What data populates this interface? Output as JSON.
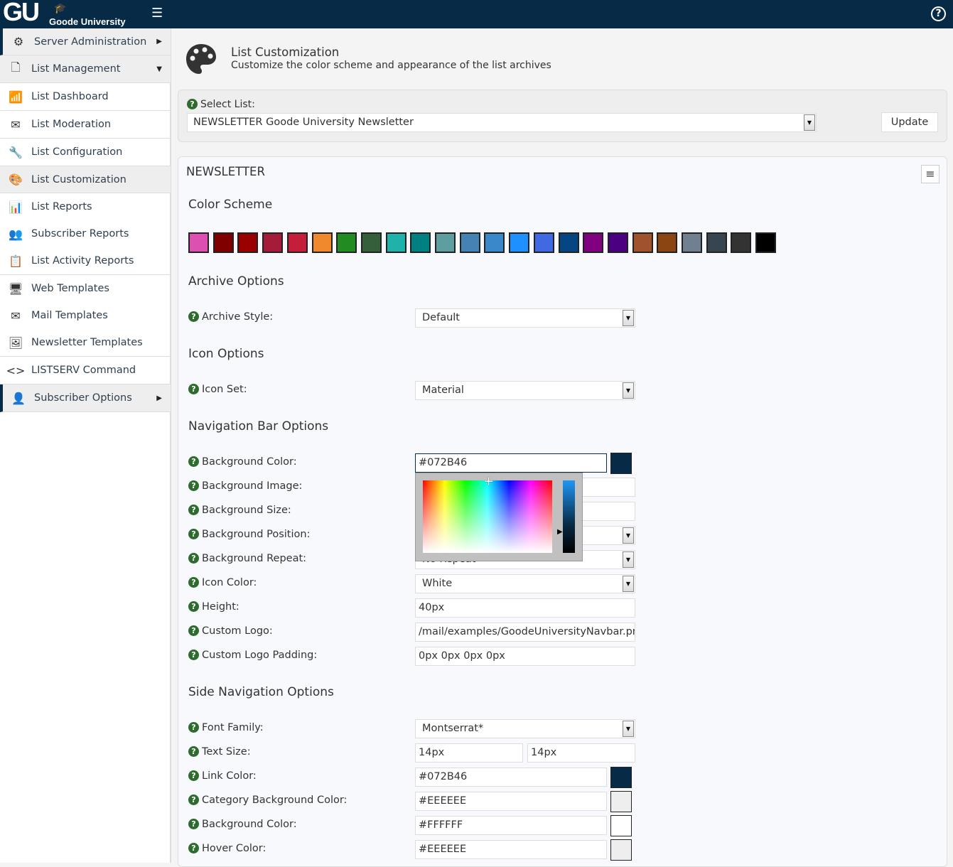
{
  "header": {
    "logo_mark": "GU",
    "logo_name": "Goode University",
    "bg": "#072B46"
  },
  "sidebar": {
    "items": [
      {
        "label": "Server Administration",
        "icon": "gear-icon",
        "glyph": "⚙",
        "arrow": "▶"
      },
      {
        "label": "List Management",
        "icon": "document-icon",
        "glyph": "🗋",
        "arrow": "▼"
      },
      {
        "label": "List Dashboard",
        "icon": "dashboard-icon",
        "glyph": "📶"
      },
      {
        "label": "List Moderation",
        "icon": "mail-search-icon",
        "glyph": "✉"
      },
      {
        "label": "List Configuration",
        "icon": "wrench-icon",
        "glyph": "🔧"
      },
      {
        "label": "List Customization",
        "icon": "palette-icon",
        "glyph": "🎨"
      },
      {
        "label": "List Reports",
        "icon": "bar-chart-icon",
        "glyph": "📊"
      },
      {
        "label": "Subscriber Reports",
        "icon": "people-icon",
        "glyph": "👥"
      },
      {
        "label": "List Activity Reports",
        "icon": "clipboard-icon",
        "glyph": "📋"
      },
      {
        "label": "Web Templates",
        "icon": "devices-icon",
        "glyph": "🖥"
      },
      {
        "label": "Mail Templates",
        "icon": "envelope-icon",
        "glyph": "✉"
      },
      {
        "label": "Newsletter Templates",
        "icon": "image-icon",
        "glyph": "🖼"
      },
      {
        "label": "LISTSERV Command",
        "icon": "code-icon",
        "glyph": "<>"
      },
      {
        "label": "Subscriber Options",
        "icon": "person-icon",
        "glyph": "👤",
        "arrow": "▶"
      }
    ]
  },
  "page": {
    "title": "List Customization",
    "subtitle": "Customize the color scheme and appearance of the list archives"
  },
  "select_list": {
    "label": "Select List:",
    "value": "NEWSLETTER Goode University Newsletter",
    "update": "Update"
  },
  "panel": {
    "title": "NEWSLETTER"
  },
  "sections": {
    "color_scheme": "Color Scheme",
    "archive": "Archive Options",
    "icon": "Icon Options",
    "navbar": "Navigation Bar Options",
    "sidenav": "Side Navigation Options"
  },
  "swatches": [
    "#DD4FB0",
    "#800000",
    "#990000",
    "#A51C3A",
    "#C41E3A",
    "#F0882E",
    "#228B22",
    "#355E3B",
    "#20B2AA",
    "#008080",
    "#5F9EA0",
    "#4682B4",
    "#3A87CA",
    "#1E90FF",
    "#4169E1",
    "#054584",
    "#800080",
    "#4B0082",
    "#A0522D",
    "#8B4513",
    "#708090",
    "#36454F",
    "#333333",
    "#000000"
  ],
  "rows": [
    {
      "label": "Archive Style:",
      "type": "select",
      "value": "Default"
    },
    {
      "label": "Icon Set:",
      "type": "select",
      "value": "Material"
    },
    {
      "label": "Background Color:",
      "type": "color",
      "value": "#072B46",
      "swatch": "#072B46"
    },
    {
      "label": "Background Image:",
      "type": "text",
      "value": ""
    },
    {
      "label": "Background Size:",
      "type": "text",
      "value": ""
    },
    {
      "label": "Background Position:",
      "type": "select",
      "value": ""
    },
    {
      "label": "Background Repeat:",
      "type": "select",
      "value": "No Repeat"
    },
    {
      "label": "Icon Color:",
      "type": "select",
      "value": "White"
    },
    {
      "label": "Height:",
      "type": "text",
      "value": "40px"
    },
    {
      "label": "Custom Logo:",
      "type": "text",
      "value": "/mail/examples/GoodeUniversityNavbar.png"
    },
    {
      "label": "Custom Logo Padding:",
      "type": "text",
      "value": "0px 0px 0px 0px"
    },
    {
      "label": "Font Family:",
      "type": "select",
      "value": "Montserrat*"
    },
    {
      "label": "Text Size:",
      "type": "pair",
      "value": "14px",
      "value2": "14px"
    },
    {
      "label": "Link Color:",
      "type": "color",
      "value": "#072B46",
      "swatch": "#072B46"
    },
    {
      "label": "Category Background Color:",
      "type": "color",
      "value": "#EEEEEE",
      "swatch": "#EEEEEE"
    },
    {
      "label": "Background Color:",
      "type": "color",
      "value": "#FFFFFF",
      "swatch": "#FFFFFF"
    },
    {
      "label": "Hover Color:",
      "type": "color",
      "value": "#EEEEEE",
      "swatch": "#EEEEEE"
    }
  ]
}
